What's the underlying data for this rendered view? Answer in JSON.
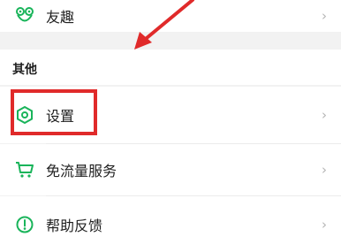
{
  "rows": {
    "youqu": {
      "label": "友趣",
      "icon": "frog-face-icon"
    },
    "settings": {
      "label": "设置",
      "icon": "hexagon-settings-icon"
    },
    "traffic": {
      "label": "免流量服务",
      "icon": "shopping-cart-icon"
    },
    "help": {
      "label": "帮助反馈",
      "icon": "info-circle-icon"
    }
  },
  "section": {
    "title": "其他"
  },
  "chevron": "›",
  "colors": {
    "accent_green": "#19b45a",
    "annotation_red": "#e02a2a"
  }
}
